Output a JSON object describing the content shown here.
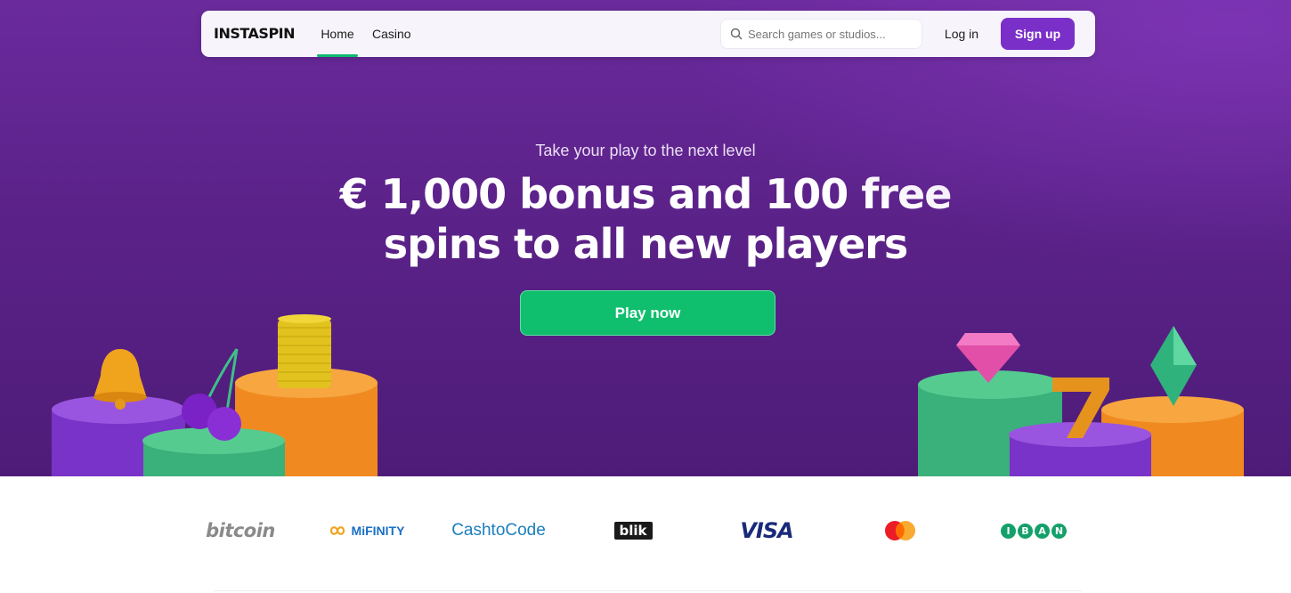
{
  "brand": {
    "logo_text": "INSTASPIN"
  },
  "nav": {
    "items": [
      {
        "label": "Home",
        "active": true
      },
      {
        "label": "Casino",
        "active": false
      }
    ],
    "search_placeholder": "Search games or studios...",
    "login_label": "Log in",
    "signup_label": "Sign up"
  },
  "hero": {
    "tagline": "Take your play to the next level",
    "headline": "€ 1,000 bonus and 100 free spins to all new players",
    "cta_label": "Play now"
  },
  "payments": {
    "methods": [
      "bitcoin",
      "MiFINITY",
      "CashtoCode",
      "blik",
      "VISA",
      "mastercard-icon",
      "IBAN"
    ],
    "bitcoin": "bitcoin",
    "mifinity": "MiFINITY",
    "cashtocode": "CashtoCode",
    "blik": "blik",
    "visa": "VISA",
    "iban_letters": [
      "I",
      "B",
      "A",
      "N"
    ]
  },
  "colors": {
    "hero_bg": "#5b2289",
    "accent": "#7b2fc9",
    "cta_green": "#10bf6d",
    "active_underline": "#10b870"
  },
  "icons": [
    "search-icon",
    "bell-icon",
    "cherry-icon",
    "coin-stack-icon",
    "diamond-icon",
    "seven-icon",
    "emerald-icon",
    "mastercard-icon"
  ]
}
